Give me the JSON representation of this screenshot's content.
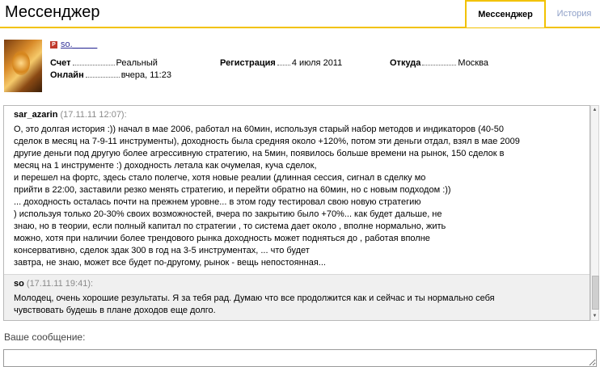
{
  "header": {
    "title": "Мессенджер",
    "tabs": [
      {
        "label": "Мессенджер",
        "active": true
      },
      {
        "label": "История",
        "active": false
      }
    ],
    "accent_color": "#f2c200"
  },
  "profile": {
    "badge": "P",
    "username": "so._____",
    "fields": {
      "account_label": "Счет",
      "account_value": "Реальный",
      "registration_label": "Регистрация",
      "registration_value": "4 июля 2011",
      "location_label": "Откуда",
      "location_value": "Москва",
      "online_label": "Онлайн",
      "online_value": "вчера, 11:23"
    }
  },
  "messages": [
    {
      "author": "sar_azarin",
      "time": "(17.11.11 12:07):",
      "lines": [
        "О, это долгая история :)) начал в мае 2006, работал на 60мин, используя старый набор методов и индикаторов (40-50",
        "сделок в месяц на 7-9-11 инструменты), доходность была средняя около +120%, потом эти деньги отдал, взял в мае 2009",
        "другие деньги под другую более агрессивную стратегию, на 5мин, появилось больше времени на рынок, 150 сделок в",
        "месяц на 1 инструменте :) доходность летала как очумелая, куча сделок,",
        "и перешел на фортс, здесь стало полегче, хотя новые реалии (длинная сессия, сигнал в сделку мо",
        "прийти в 22:00, заставили резко менять стратегию, и перейти обратно на 60мин, но с новым подходом :))",
        "... доходность осталась почти на прежнем уровне... в этом году тестировал свою новую стратегию",
        ") используя только 20-30% своих возможностей, вчера по закрытию было +70%... как будет дальше, не",
        "знаю, но в теории, если полный капитал по стратегии , то система дает около , вполне нормально, жить",
        "можно, хотя при наличии более трендового рынка доходность может подняться до , работая вполне",
        "консервативно, сделок здак 300 в год на 3-5 инструментах, ... что будет",
        "завтра, не знаю, может все будет по-другому, рынок - вещь непостоянная..."
      ]
    },
    {
      "author": "so",
      "time": "(17.11.11 19:41):",
      "lines": [
        "Молодец, очень хорошие результаты. Я за тебя рад. Думаю что все продолжится как и сейчас и ты нормально себя",
        "чувствовать будешь в плане доходов еще долго."
      ]
    }
  ],
  "compose": {
    "label": "Ваше сообщение:",
    "value": ""
  }
}
